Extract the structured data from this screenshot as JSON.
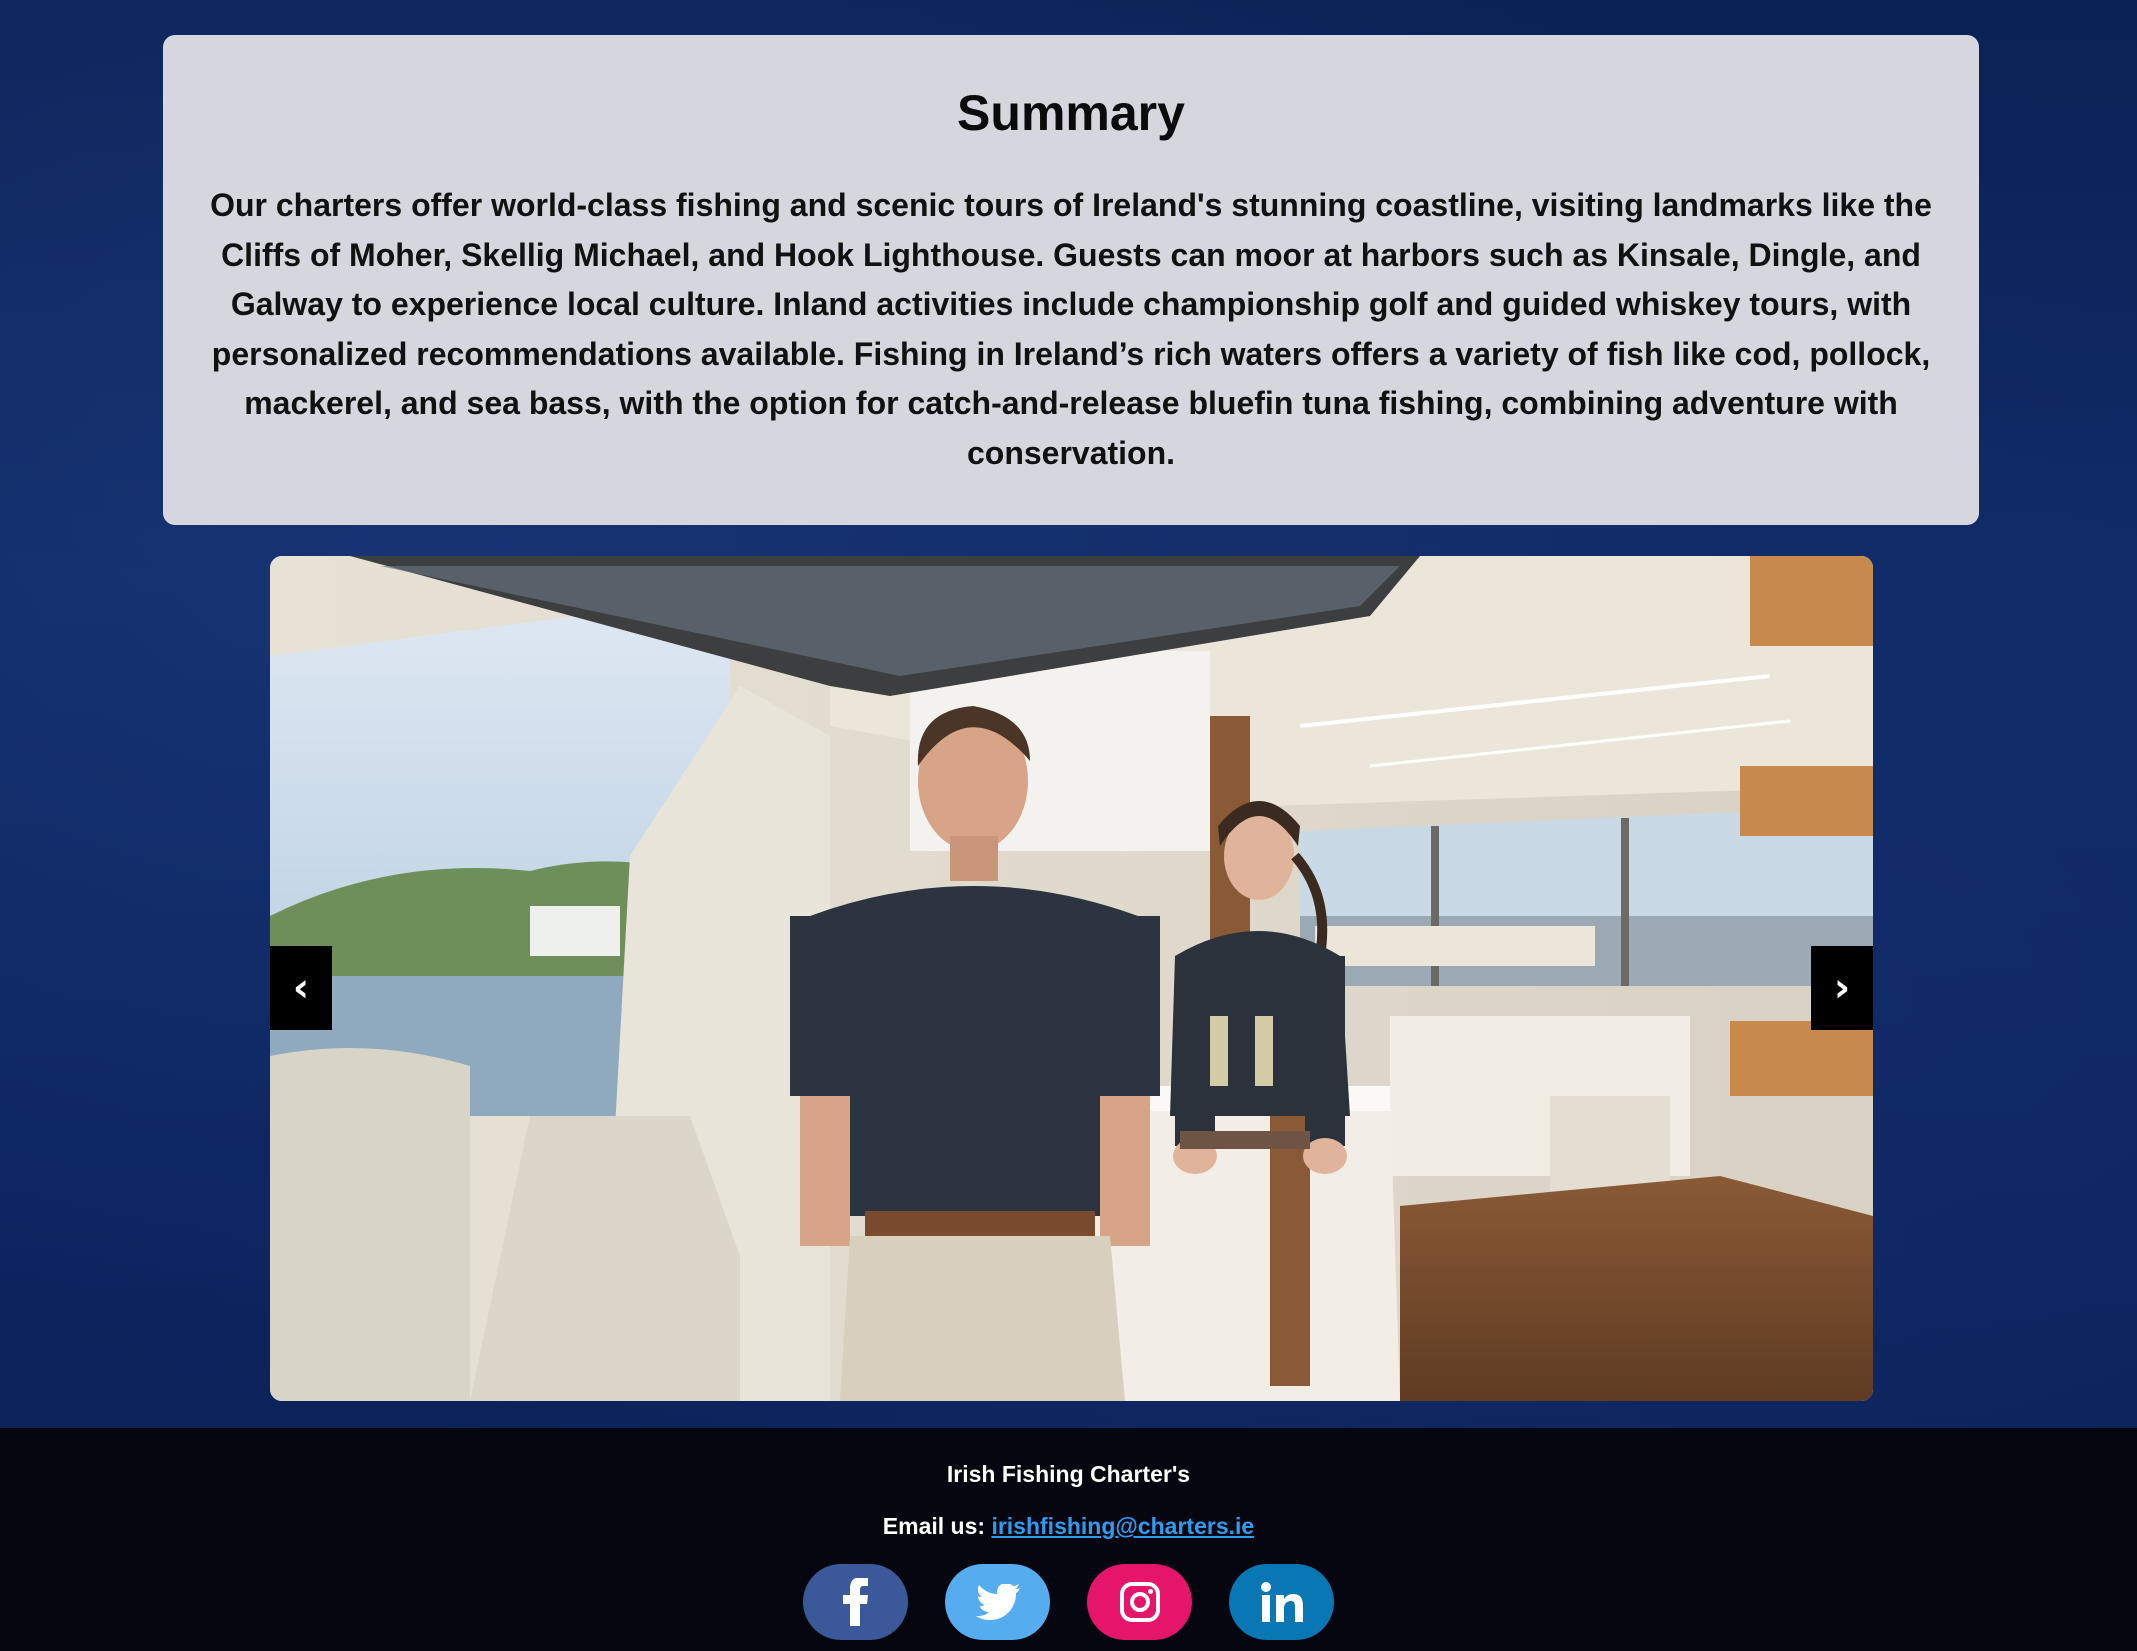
{
  "summary": {
    "title": "Summary",
    "text": "Our charters offer world-class fishing and scenic tours of Ireland's stunning coastline, visiting landmarks like the Cliffs of Moher, Skellig Michael, and Hook Lighthouse. Guests can moor at harbors such as Kinsale, Dingle, and Galway to experience local culture. Inland activities include championship golf and guided whiskey tours, with personalized recommendations available. Fishing in Ireland’s rich waters offers a variety of fish like cod, pollock, mackerel, and sea bass, with the option for catch-and-release bluefin tuna fishing, combining adventure with conservation."
  },
  "carousel": {
    "prev_label": "‹",
    "next_label": "›",
    "slide_icon": "yacht-crew-photo"
  },
  "footer": {
    "brand": "Irish Fishing Charter's",
    "email_prefix": "Email us: ",
    "email": "irishfishing@charters.ie",
    "socials": [
      {
        "name": "facebook",
        "icon": "facebook-icon",
        "color": "#3b5998"
      },
      {
        "name": "twitter",
        "icon": "twitter-icon",
        "color": "#55acee"
      },
      {
        "name": "instagram",
        "icon": "instagram-icon",
        "color": "#e4156b"
      },
      {
        "name": "linkedin",
        "icon": "linkedin-icon",
        "color": "#0a77b5"
      }
    ]
  }
}
